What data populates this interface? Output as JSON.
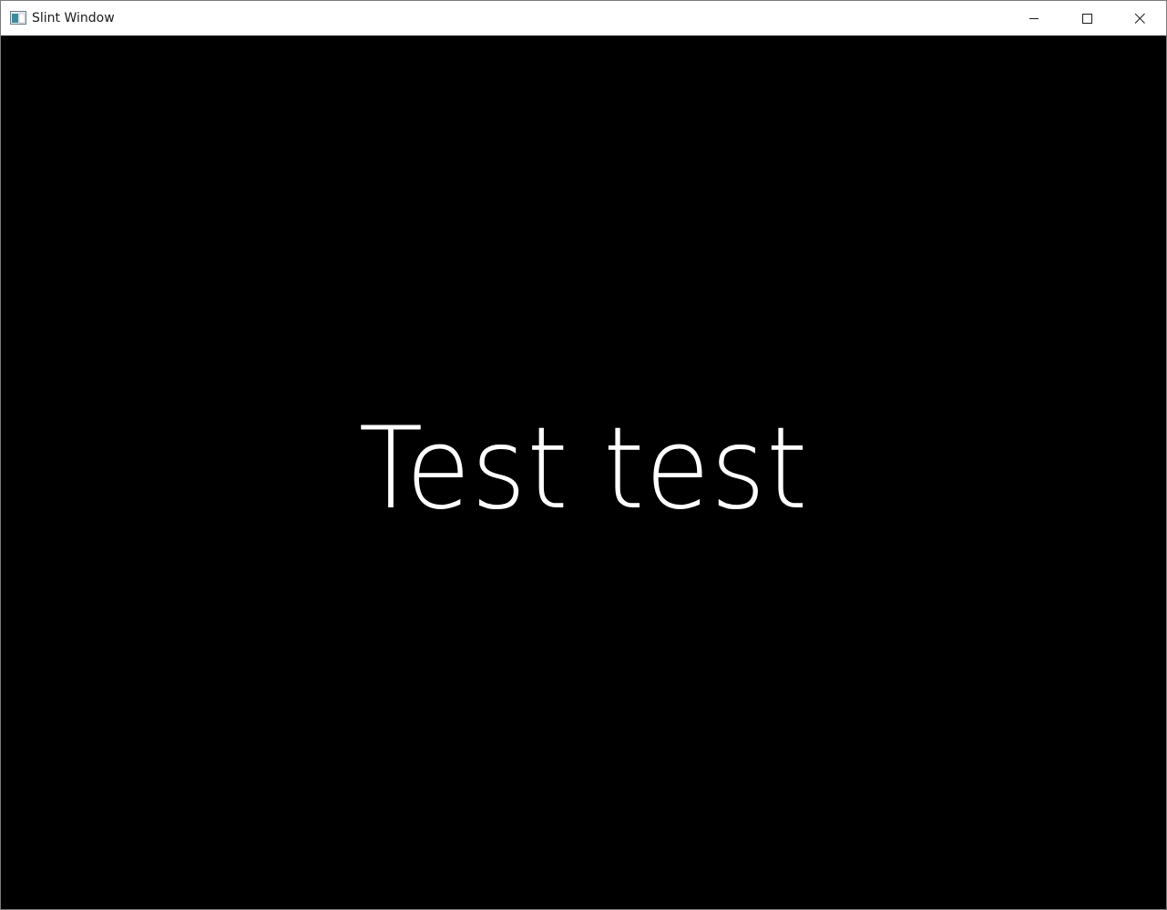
{
  "window": {
    "title": "Slint Window",
    "icon": "app-window-icon",
    "controls": {
      "minimize": "minimize-icon",
      "maximize": "maximize-icon",
      "close": "close-icon"
    }
  },
  "content": {
    "text": "Test test",
    "background_color": "#000000",
    "text_color": "#ffffff"
  }
}
